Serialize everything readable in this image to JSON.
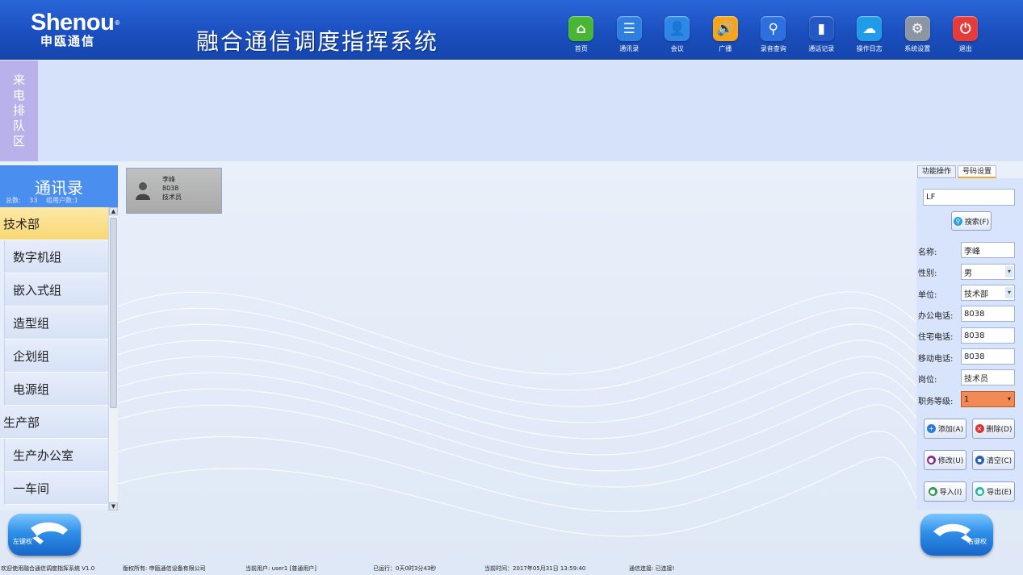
{
  "header": {
    "logo_main": "Shenou",
    "logo_reg": "®",
    "logo_sub": "申瓯通信",
    "title": "融合通信调度指挥系统",
    "tools": [
      {
        "label": "首页",
        "icon": "home-icon",
        "color": "#49b534",
        "glyph": "⌂"
      },
      {
        "label": "通讯录",
        "icon": "list-icon",
        "color": "#2d7fe0",
        "glyph": "☰"
      },
      {
        "label": "会议",
        "icon": "meeting-icon",
        "color": "#2e86e6",
        "glyph": "👤"
      },
      {
        "label": "广播",
        "icon": "broadcast-icon",
        "color": "#f4a51c",
        "glyph": "🔊"
      },
      {
        "label": "录音查询",
        "icon": "search-icon",
        "color": "#2e6fe0",
        "glyph": "⚲"
      },
      {
        "label": "通话记录",
        "icon": "records-icon",
        "color": "#2458c4",
        "glyph": "▮"
      },
      {
        "label": "操作日志",
        "icon": "cloud-icon",
        "color": "#1f9be8",
        "glyph": "☁"
      },
      {
        "label": "系统设置",
        "icon": "gear-icon",
        "color": "#8c95a3",
        "glyph": "⚙"
      },
      {
        "label": "退出",
        "icon": "power-icon",
        "color": "#e53b3b",
        "glyph": "⏻"
      }
    ]
  },
  "queue": {
    "label_chars": [
      "来",
      "电",
      "排",
      "队",
      "区"
    ]
  },
  "contacts": {
    "title": "通讯录",
    "stats": "总数: 33    组用户数:1",
    "groups": [
      {
        "label": "技术部",
        "level": "parent",
        "selected": true
      },
      {
        "label": "数字机组",
        "level": "child"
      },
      {
        "label": "嵌入式组",
        "level": "child"
      },
      {
        "label": "造型组",
        "level": "child"
      },
      {
        "label": "企划组",
        "level": "child"
      },
      {
        "label": "电源组",
        "level": "child"
      },
      {
        "label": "生产部",
        "level": "parent"
      },
      {
        "label": "生产办公室",
        "level": "child"
      },
      {
        "label": "一车间",
        "level": "child"
      }
    ]
  },
  "card": {
    "name": "李峰",
    "ext": "8038",
    "role": "技术员"
  },
  "panel": {
    "tab_ops": "功能操作",
    "tab_number": "号码设置",
    "search_value": "LF",
    "search_btn": "搜索(F)",
    "fields": {
      "name_label": "名称:",
      "name_value": "李峰",
      "gender_label": "性别:",
      "gender_value": "男",
      "unit_label": "单位:",
      "unit_value": "技术部",
      "office_label": "办公电话:",
      "office_value": "8038",
      "home_label": "住宅电话:",
      "home_value": "8038",
      "mobile_label": "移动电话:",
      "mobile_value": "8038",
      "post_label": "岗位:",
      "post_value": "技术员",
      "rank_label": "职务等级:",
      "rank_value": "1"
    },
    "buttons": {
      "add": "添加(A)",
      "delete": "删除(D)",
      "modify": "修改(U)",
      "clear": "清空(C)",
      "import": "导入(I)",
      "export": "导出(E)"
    }
  },
  "handsets": {
    "left": "左键权",
    "right": "右键权"
  },
  "status": {
    "welcome": "欢迎使用融合通信调度指挥系统 V1.0",
    "copyright": "版权所有: 申瓯通信设备有限公司",
    "user": "当前用户: user1 [普通用户]",
    "runtime": "已运行：0天0时3分43秒",
    "time": "当前时间：2017年05月31日 13:59:40",
    "connection": "通信连接: 已连接!"
  }
}
